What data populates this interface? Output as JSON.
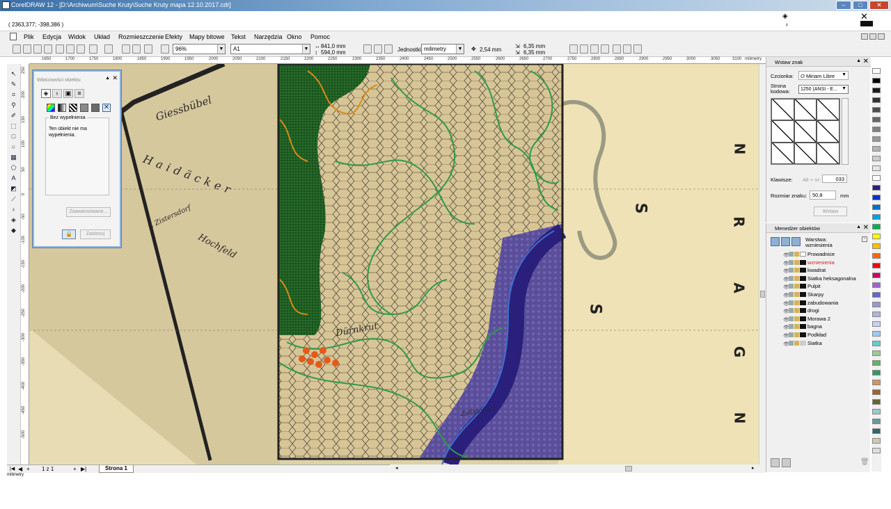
{
  "window": {
    "title": "CorelDRAW 12 - [D:\\Archiwum\\Suche Kruty\\Suche Kruty mapa 12.10.2017.cdr]",
    "coords": "( 2363,377; -398,386 )"
  },
  "menu": [
    "Plik",
    "Edycja",
    "Widok",
    "Układ",
    "Rozmieszczenie",
    "Efekty",
    "Mapy bitowe",
    "Tekst",
    "Narzędzia",
    "Okno",
    "Pomoc"
  ],
  "toolbar": {
    "zoom": "96%",
    "page_size": "A1",
    "width": "841,0 mm",
    "height": "594,0 mm",
    "units_label": "Jednostki:",
    "units_value": "milimetry",
    "nudge": "2,54 mm",
    "dup_x": "6,35 mm",
    "dup_y": "6,35 mm"
  },
  "ruler": {
    "h_ticks": [
      "1650",
      "1700",
      "1750",
      "1800",
      "1850",
      "1900",
      "1950",
      "2000",
      "2050",
      "2100",
      "2150",
      "2200",
      "2250",
      "2300",
      "2350",
      "2400",
      "2450",
      "2500",
      "2550",
      "2600",
      "2650",
      "2700",
      "2750",
      "2800",
      "2850",
      "2900",
      "2950",
      "3000",
      "3050",
      "3100"
    ],
    "unit": "milimetry",
    "v_ticks": [
      "250",
      "200",
      "150",
      "100",
      "50",
      "0",
      "-50",
      "-100",
      "-150",
      "-200",
      "-250",
      "-300",
      "-350",
      "-400",
      "-450",
      "-500"
    ]
  },
  "map_labels": {
    "n1": "N",
    "s1": "S",
    "r": "R",
    "a": "A",
    "s2": "S",
    "g": "G",
    "n2": "N",
    "giessbubel": "Giessbübel",
    "haidacker": "Haidäcker",
    "hochfeld": "Hochfeld",
    "zistersdorf": "v. Zistersdorf",
    "durnkrut": "Dürnkrut",
    "zoll": "Zollstation"
  },
  "properties_dialog": {
    "title": "Właściwości obiektu",
    "fill_name": "Bez wypełnienia",
    "fill_desc": "Ten obiekt nie ma wypełnienia.",
    "advanced": "Zaawansowane...",
    "apply": "Zastosuj"
  },
  "insert_glyph": {
    "title": "Wstaw znak",
    "font_label": "Czcionka:",
    "font_value": "Miriam Libre",
    "codepage_label": "Strona kodowa:",
    "codepage_value": "1250  (ANSI - E...",
    "keys_label": "Klawisze:",
    "keys_hint": "Alt + nr:",
    "keys_value": "033",
    "size_label": "Rozmiar znaku:",
    "size_value": "50,8",
    "size_unit": "mm",
    "insert_btn": "Wstaw"
  },
  "object_manager": {
    "title": "Menedżer obiektów",
    "current_layer_label": "Warstwa:",
    "current_layer_value": "wzniesienia",
    "layers": [
      {
        "name": "Prowadnice",
        "active": false,
        "swatch": "#ffffff"
      },
      {
        "name": "wzniesienia",
        "active": true,
        "swatch": "#111111"
      },
      {
        "name": "kwadrat",
        "active": false,
        "swatch": "#111111"
      },
      {
        "name": "Siatka heksagonalna",
        "active": false,
        "swatch": "#111111"
      },
      {
        "name": "Pulpit",
        "active": false,
        "swatch": "#111111"
      },
      {
        "name": "Skarpy",
        "active": false,
        "swatch": "#111111"
      },
      {
        "name": "zabudowania",
        "active": false,
        "swatch": "#111111"
      },
      {
        "name": "drogi",
        "active": false,
        "swatch": "#111111"
      },
      {
        "name": "Morawa 2",
        "active": false,
        "swatch": "#111111"
      },
      {
        "name": "bagna",
        "active": false,
        "swatch": "#111111"
      },
      {
        "name": "Podkład",
        "active": false,
        "swatch": "#111111"
      },
      {
        "name": "Siatka",
        "active": false,
        "swatch": "#cccccc"
      }
    ]
  },
  "pagebar": {
    "page_counter": "1 z 1",
    "page_tab": "Strona 1"
  },
  "colors": {
    "accent_blue": "#3a6ea5",
    "river": "#2a1f7a",
    "swamp": "#5a4e9a",
    "forest": "#1f5a24",
    "contour_green": "#2e9a4a",
    "contour_orange": "#d98a1a",
    "active_layer": "#d0202a"
  },
  "palette": [
    "#ffffff",
    "#000000",
    "#1a1a1a",
    "#333333",
    "#4d4d4d",
    "#666666",
    "#808080",
    "#999999",
    "#b3b3b3",
    "#cccccc",
    "#e6e6e6",
    "#ffffff",
    "#2a1f7a",
    "#0033cc",
    "#0070c0",
    "#00a0e0",
    "#00b050",
    "#ffff00",
    "#ffc000",
    "#ff6600",
    "#ff0000",
    "#cc0066",
    "#9966cc",
    "#6666cc",
    "#9999cc",
    "#b3b3d9",
    "#ccccff",
    "#99ccff",
    "#66cccc",
    "#99cc99",
    "#66b266",
    "#339966",
    "#cc9966",
    "#996633",
    "#666633",
    "#99cccc",
    "#669999",
    "#336666",
    "#ccccaa",
    "#dddddd"
  ]
}
